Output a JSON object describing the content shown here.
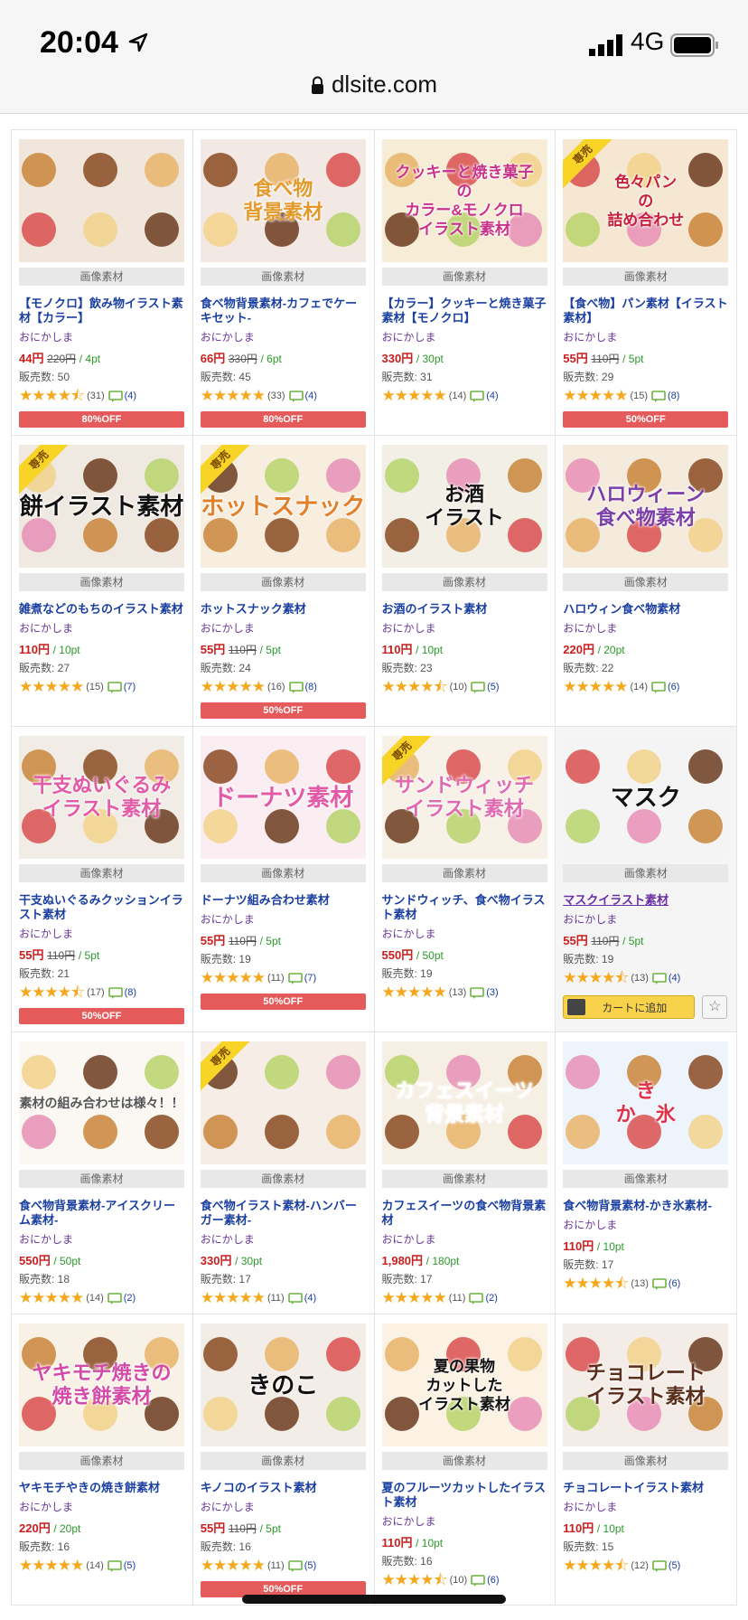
{
  "status_bar": {
    "time": "20:04",
    "network": "4G"
  },
  "url_bar": {
    "domain": "dlsite.com"
  },
  "exclusive_label": "専売",
  "cart_label": "カートに追加",
  "products": [
    {
      "title": "【モノクロ】飲み物イラスト素材【カラー】",
      "maker": "おにかしま",
      "price": "44円",
      "original_price": "220円",
      "points": "/ 4pt",
      "sales": "販売数: 50",
      "rating": 4.5,
      "reviews": "(31)",
      "comments": "(4)",
      "badge": "80%OFF",
      "category": "画像素材",
      "exclusive": false,
      "overlay": ""
    },
    {
      "title": "食べ物背景素材-カフェでケーキセット-",
      "maker": "おにかしま",
      "price": "66円",
      "original_price": "330円",
      "points": "/ 6pt",
      "sales": "販売数: 45",
      "rating": 5,
      "reviews": "(33)",
      "comments": "(4)",
      "badge": "80%OFF",
      "category": "画像素材",
      "exclusive": false,
      "overlay": "食べ物\n背景素材"
    },
    {
      "title": "【カラー】クッキーと焼き菓子素材【モノクロ】",
      "maker": "おにかしま",
      "price": "330円",
      "original_price": "",
      "points": "/ 30pt",
      "sales": "販売数: 31",
      "rating": 5,
      "reviews": "(14)",
      "comments": "(4)",
      "badge": "",
      "category": "画像素材",
      "exclusive": false,
      "overlay": "クッキーと焼き菓子\nの\nカラー&モノクロ\nイラスト素材"
    },
    {
      "title": "【食べ物】パン素材【イラスト素材】",
      "maker": "おにかしま",
      "price": "55円",
      "original_price": "110円",
      "points": "/ 5pt",
      "sales": "販売数: 29",
      "rating": 5,
      "reviews": "(15)",
      "comments": "(8)",
      "badge": "50%OFF",
      "category": "画像素材",
      "exclusive": true,
      "overlay": "色々パン\nの\n詰め合わせ"
    },
    {
      "title": "雑煮などのもちのイラスト素材",
      "maker": "おにかしま",
      "price": "110円",
      "original_price": "",
      "points": "/ 10pt",
      "sales": "販売数: 27",
      "rating": 5,
      "reviews": "(15)",
      "comments": "(7)",
      "badge": "",
      "category": "画像素材",
      "exclusive": true,
      "overlay": "餅イラスト素材"
    },
    {
      "title": "ホットスナック素材",
      "maker": "おにかしま",
      "price": "55円",
      "original_price": "110円",
      "points": "/ 5pt",
      "sales": "販売数: 24",
      "rating": 5,
      "reviews": "(16)",
      "comments": "(8)",
      "badge": "50%OFF",
      "category": "画像素材",
      "exclusive": true,
      "overlay": "ホットスナック"
    },
    {
      "title": "お酒のイラスト素材",
      "maker": "おにかしま",
      "price": "110円",
      "original_price": "",
      "points": "/ 10pt",
      "sales": "販売数: 23",
      "rating": 4.5,
      "reviews": "(10)",
      "comments": "(5)",
      "badge": "",
      "category": "画像素材",
      "exclusive": false,
      "overlay": "お酒\nイラスト"
    },
    {
      "title": "ハロウィン食べ物素材",
      "maker": "おにかしま",
      "price": "220円",
      "original_price": "",
      "points": "/ 20pt",
      "sales": "販売数: 22",
      "rating": 5,
      "reviews": "(14)",
      "comments": "(6)",
      "badge": "",
      "category": "画像素材",
      "exclusive": false,
      "overlay": "ハロウィーン\n食べ物素材"
    },
    {
      "title": "干支ぬいぐるみクッションイラスト素材",
      "maker": "おにかしま",
      "price": "55円",
      "original_price": "110円",
      "points": "/ 5pt",
      "sales": "販売数: 21",
      "rating": 4.5,
      "reviews": "(17)",
      "comments": "(8)",
      "badge": "50%OFF",
      "category": "画像素材",
      "exclusive": false,
      "overlay": "干支ぬいぐるみ\nイラスト素材"
    },
    {
      "title": "ドーナツ組み合わせ素材",
      "maker": "おにかしま",
      "price": "55円",
      "original_price": "110円",
      "points": "/ 5pt",
      "sales": "販売数: 19",
      "rating": 5,
      "reviews": "(11)",
      "comments": "(7)",
      "badge": "50%OFF",
      "category": "画像素材",
      "exclusive": false,
      "overlay": "ドーナツ素材"
    },
    {
      "title": "サンドウィッチ、食べ物イラスト素材",
      "maker": "おにかしま",
      "price": "550円",
      "original_price": "",
      "points": "/ 50pt",
      "sales": "販売数: 19",
      "rating": 5,
      "reviews": "(13)",
      "comments": "(3)",
      "badge": "",
      "category": "画像素材",
      "exclusive": true,
      "overlay": "サンドウィッチ\nイラスト素材"
    },
    {
      "title": "マスクイラスト素材",
      "maker": "おにかしま",
      "price": "55円",
      "original_price": "110円",
      "points": "/ 5pt",
      "sales": "販売数: 19",
      "rating": 4.5,
      "reviews": "(13)",
      "comments": "(4)",
      "badge": "",
      "category": "画像素材",
      "exclusive": false,
      "overlay": "マスク",
      "visited": true,
      "cart": true
    },
    {
      "title": "食べ物背景素材-アイスクリーム素材-",
      "maker": "おにかしま",
      "price": "550円",
      "original_price": "",
      "points": "/ 50pt",
      "sales": "販売数: 18",
      "rating": 5,
      "reviews": "(14)",
      "comments": "(2)",
      "badge": "",
      "category": "画像素材",
      "exclusive": false,
      "overlay": "素材の組み合わせは様々！！"
    },
    {
      "title": "食べ物イラスト素材-ハンバーガー素材-",
      "maker": "おにかしま",
      "price": "330円",
      "original_price": "",
      "points": "/ 30pt",
      "sales": "販売数: 17",
      "rating": 5,
      "reviews": "(11)",
      "comments": "(4)",
      "badge": "",
      "category": "画像素材",
      "exclusive": true,
      "overlay": ""
    },
    {
      "title": "カフェスイーツの食べ物背景素材",
      "maker": "おにかしま",
      "price": "1,980円",
      "original_price": "",
      "points": "/ 180pt",
      "sales": "販売数: 17",
      "rating": 5,
      "reviews": "(11)",
      "comments": "(2)",
      "badge": "",
      "category": "画像素材",
      "exclusive": false,
      "overlay": "カフェスイーツ\n背景素材"
    },
    {
      "title": "食べ物背景素材-かき氷素材-",
      "maker": "おにかしま",
      "price": "110円",
      "original_price": "",
      "points": "/ 10pt",
      "sales": "販売数: 17",
      "rating": 4.5,
      "reviews": "(13)",
      "comments": "(6)",
      "badge": "",
      "category": "画像素材",
      "exclusive": false,
      "overlay": "き\nか　氷"
    },
    {
      "title": "ヤキモチやきの焼き餅素材",
      "maker": "おにかしま",
      "price": "220円",
      "original_price": "",
      "points": "/ 20pt",
      "sales": "販売数: 16",
      "rating": 5,
      "reviews": "(14)",
      "comments": "(5)",
      "badge": "",
      "category": "画像素材",
      "exclusive": false,
      "overlay": "ヤキモチ焼きの\n焼き餅素材"
    },
    {
      "title": "キノコのイラスト素材",
      "maker": "おにかしま",
      "price": "55円",
      "original_price": "110円",
      "points": "/ 5pt",
      "sales": "販売数: 16",
      "rating": 5,
      "reviews": "(11)",
      "comments": "(5)",
      "badge": "50%OFF",
      "category": "画像素材",
      "exclusive": false,
      "overlay": "きのこ"
    },
    {
      "title": "夏のフルーツカットしたイラスト素材",
      "maker": "おにかしま",
      "price": "110円",
      "original_price": "",
      "points": "/ 10pt",
      "sales": "販売数: 16",
      "rating": 4.5,
      "reviews": "(10)",
      "comments": "(6)",
      "badge": "",
      "category": "画像素材",
      "exclusive": false,
      "overlay": "夏の果物\nカットした\nイラスト素材"
    },
    {
      "title": "チョコレートイラスト素材",
      "maker": "おにかしま",
      "price": "110円",
      "original_price": "",
      "points": "/ 10pt",
      "sales": "販売数: 15",
      "rating": 4.5,
      "reviews": "(12)",
      "comments": "(5)",
      "badge": "",
      "category": "画像素材",
      "exclusive": false,
      "overlay": "チョコレート\nイラスト素材"
    }
  ],
  "thumb_colors": [
    "#f0e6dc",
    "#f3e9e4",
    "#f7ecd6",
    "#f5e7d2",
    "#efe9e2",
    "#f8eee0",
    "#f2efe6",
    "#f4ebdd",
    "#f1ede6",
    "#fbeef3",
    "#f7f1e7",
    "#f4f4f4",
    "#fbf7f2",
    "#f6eee6",
    "#f6efe4",
    "#eef4fb",
    "#f8f1e6",
    "#f3ede7",
    "#fbf2e3",
    "#f4ece6"
  ],
  "overlay_colors": [
    "#333",
    "#e39a2c",
    "#c9328a",
    "#c7203a",
    "#111",
    "#e0802a",
    "#111",
    "#7b3ea8",
    "#e35aa6",
    "#e35aa6",
    "#e06ab0",
    "#111",
    "#555",
    "#333",
    "#fff",
    "#e0334b",
    "#d44aa8",
    "#111",
    "#111",
    "#5a2e1c"
  ]
}
